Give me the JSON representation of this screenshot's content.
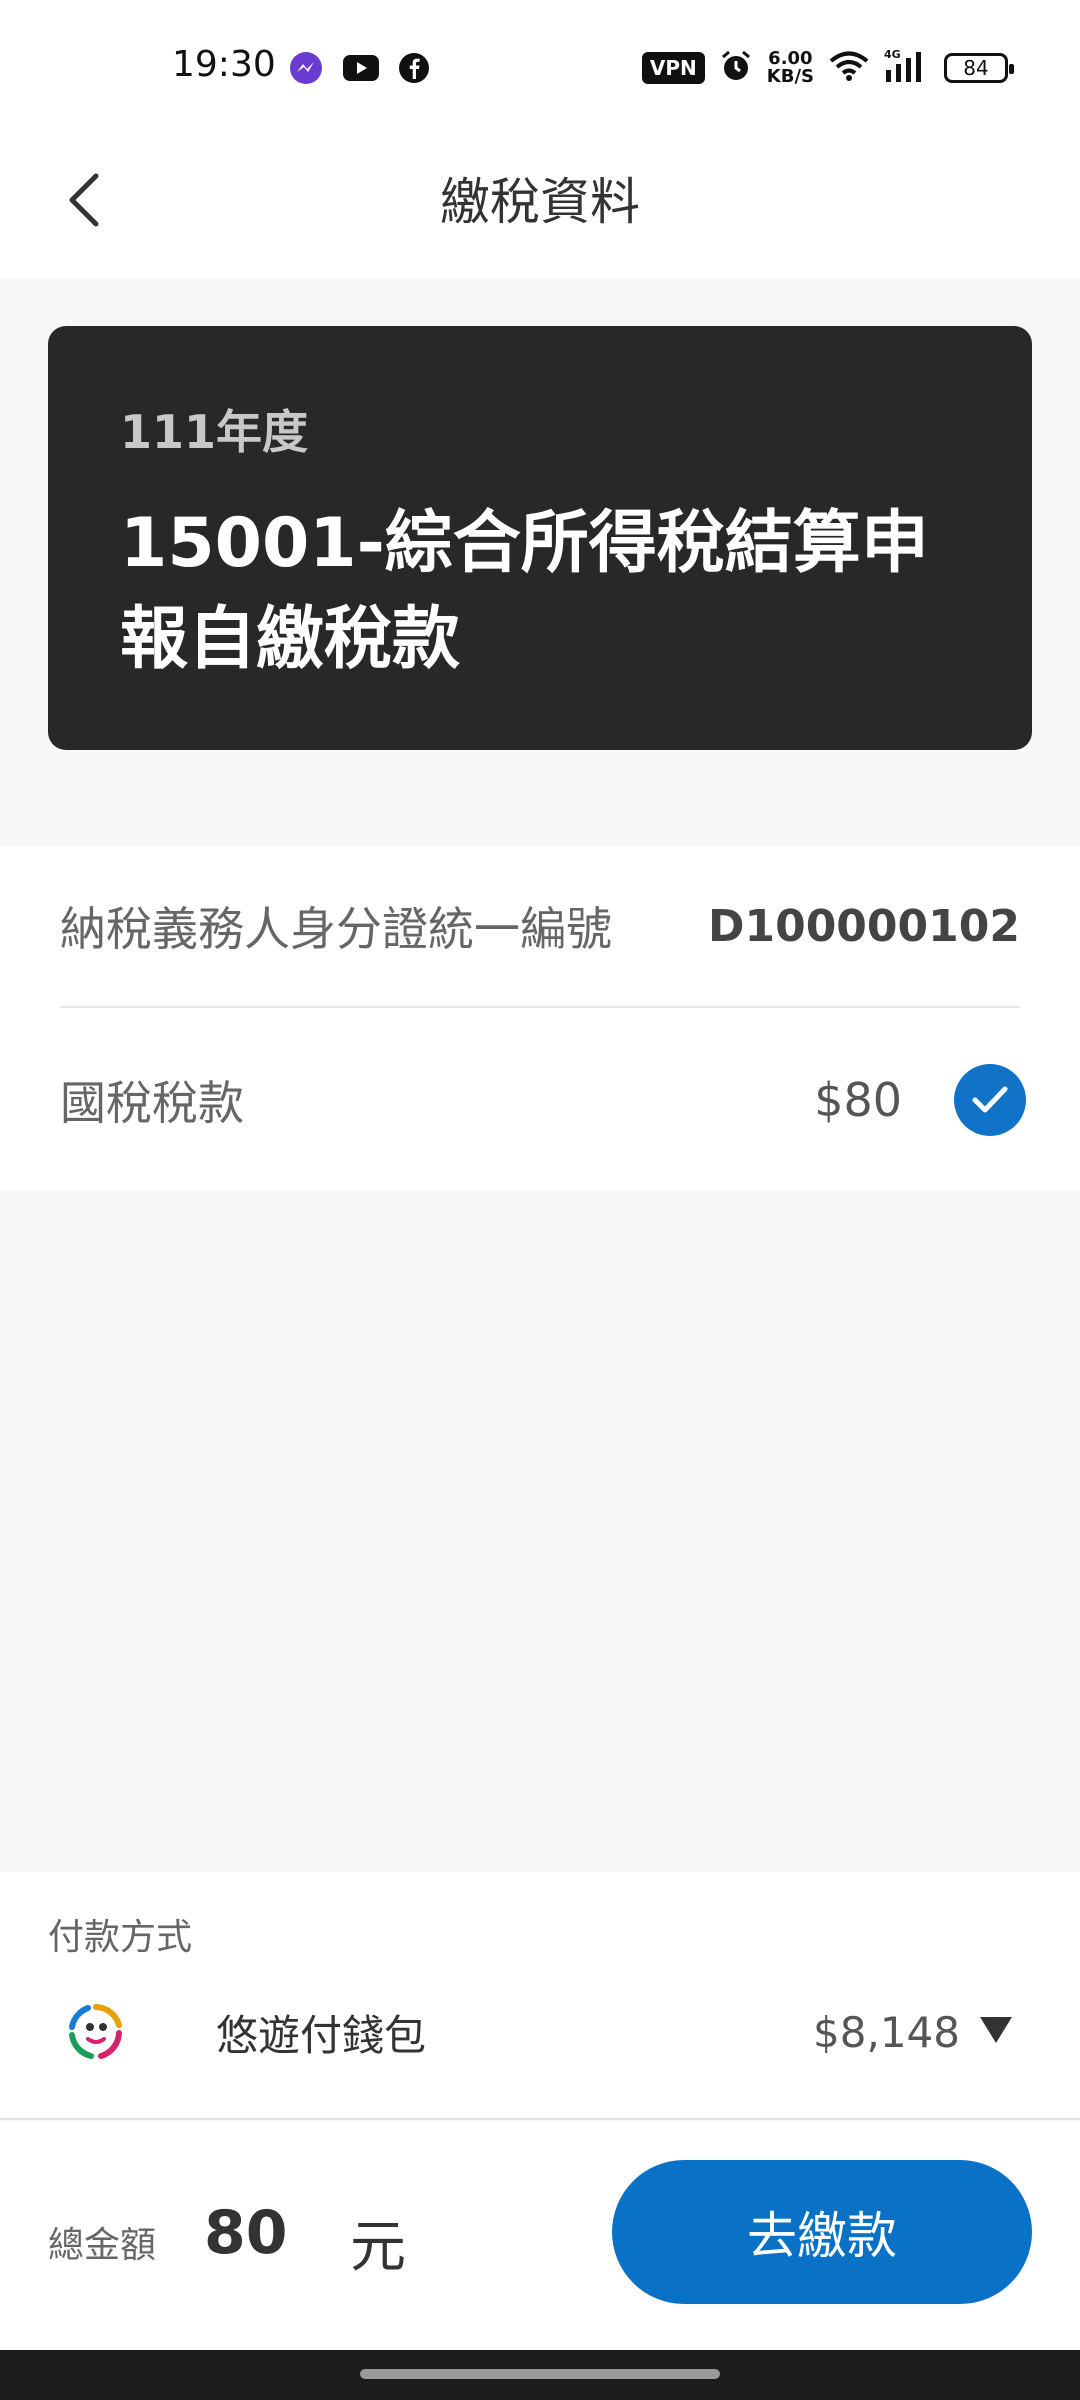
{
  "status_bar": {
    "time": "19:30",
    "left_icons": [
      "messenger-icon",
      "youtube-icon",
      "facebook-icon"
    ],
    "vpn": "VPN",
    "net_speed_value": "6.00",
    "net_speed_unit": "KB/S",
    "network_type": "4G",
    "battery": "84"
  },
  "header": {
    "title": "繳稅資料"
  },
  "tax_card": {
    "year": "111年度",
    "item_title": "15001-綜合所得稅結算申報自繳稅款"
  },
  "info": {
    "id_label": "納稅義務人身分證統一編號",
    "id_value": "D100000102",
    "tax_label": "國稅稅款",
    "tax_amount": "$80",
    "tax_selected": true
  },
  "payment": {
    "label": "付款方式",
    "wallet_name": "悠遊付錢包",
    "wallet_balance": "$8,148"
  },
  "footer": {
    "total_label": "總金額",
    "total_amount": "80",
    "total_unit": "元",
    "pay_button": "去繳款"
  },
  "colors": {
    "accent": "#0a72c6",
    "card_bg": "#282828",
    "page_bg": "#f7f7f7"
  }
}
